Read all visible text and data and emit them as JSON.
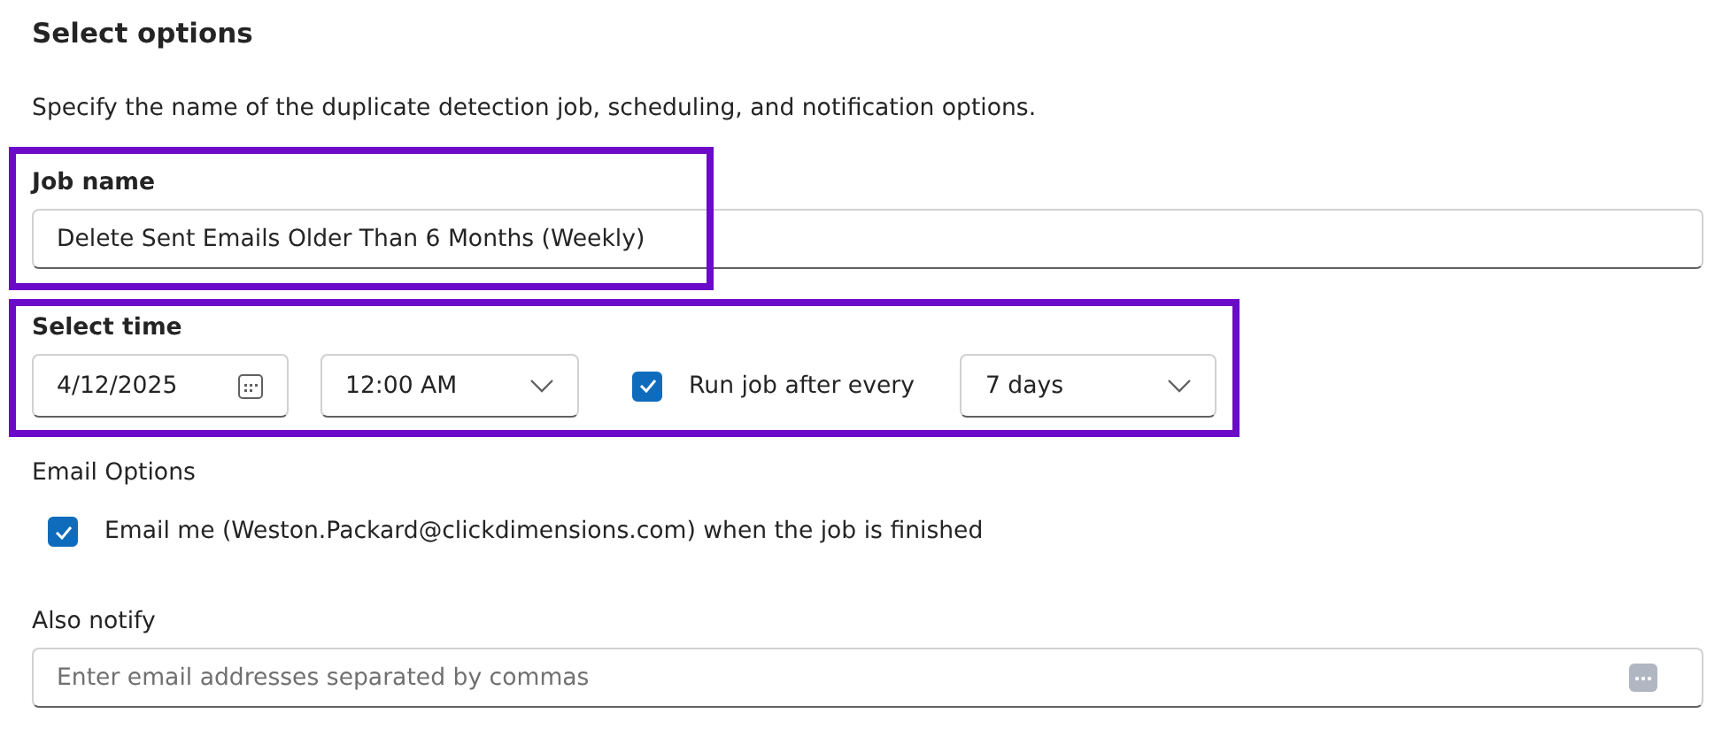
{
  "section": {
    "title": "Select options",
    "description": "Specify the name of the duplicate detection job, scheduling, and notification options."
  },
  "job_name": {
    "label": "Job name",
    "value": "Delete Sent Emails Older Than 6 Months (Weekly)",
    "highlighted": true
  },
  "select_time": {
    "label": "Select time",
    "date": "4/12/2025",
    "time": "12:00 AM",
    "run_every": {
      "label": "Run job after every",
      "checked": true
    },
    "interval": "7 days",
    "highlighted": true
  },
  "email_options": {
    "label": "Email Options",
    "email_me": {
      "label": "Email me (Weston.Packard@clickdimensions.com) when the job is finished",
      "checked": true
    }
  },
  "also_notify": {
    "label": "Also notify",
    "placeholder": "Enter email addresses separated by commas"
  }
}
